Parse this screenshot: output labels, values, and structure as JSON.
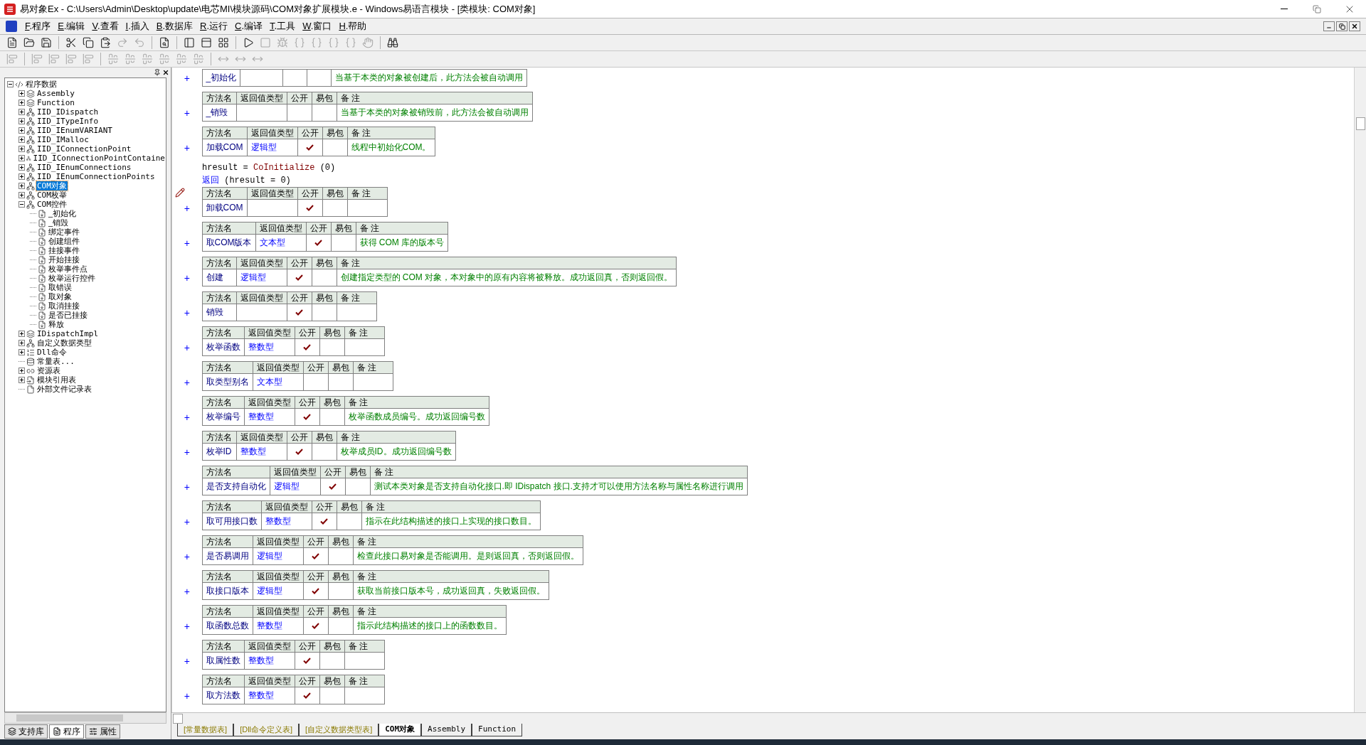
{
  "window": {
    "title": "易对象Ex - C:\\Users\\Admin\\Desktop\\update\\电芯MI\\模块源码\\COM对象扩展模块.e - Windows易语言模块 - [类模块: COM对象]"
  },
  "menu": [
    {
      "label": "F.程序"
    },
    {
      "label": "E.编辑"
    },
    {
      "label": "V.查看"
    },
    {
      "label": "I.插入"
    },
    {
      "label": "B.数据库"
    },
    {
      "label": "R.运行"
    },
    {
      "label": "C.编译"
    },
    {
      "label": "T.工具"
    },
    {
      "label": "W.窗口"
    },
    {
      "label": "H.帮助"
    }
  ],
  "toolbars": [
    [
      {
        "kind": "new",
        "disabled": false
      },
      {
        "kind": "open",
        "disabled": false
      },
      {
        "kind": "save",
        "disabled": false
      },
      {
        "kind": "sep"
      },
      {
        "kind": "cut",
        "disabled": false
      },
      {
        "kind": "copy",
        "disabled": false
      },
      {
        "kind": "paste",
        "disabled": false
      },
      {
        "kind": "redo",
        "disabled": true
      },
      {
        "kind": "undo",
        "disabled": true
      },
      {
        "kind": "sep"
      },
      {
        "kind": "find",
        "disabled": false
      },
      {
        "kind": "sep"
      },
      {
        "kind": "panel-left",
        "disabled": false
      },
      {
        "kind": "panel-top",
        "disabled": false
      },
      {
        "kind": "panel-grid",
        "disabled": false
      },
      {
        "kind": "sep"
      },
      {
        "kind": "run",
        "disabled": false
      },
      {
        "kind": "stop",
        "disabled": true
      },
      {
        "kind": "debug",
        "disabled": true
      },
      {
        "kind": "braces",
        "disabled": true
      },
      {
        "kind": "braces",
        "disabled": true
      },
      {
        "kind": "braces",
        "disabled": true
      },
      {
        "kind": "braces",
        "disabled": true
      },
      {
        "kind": "hand",
        "disabled": true
      },
      {
        "kind": "sep"
      },
      {
        "kind": "help",
        "disabled": false
      }
    ],
    [
      {
        "kind": "align",
        "disabled": true
      },
      {
        "kind": "sep"
      },
      {
        "kind": "align",
        "disabled": true
      },
      {
        "kind": "align",
        "disabled": true
      },
      {
        "kind": "align",
        "disabled": true
      },
      {
        "kind": "align",
        "disabled": true
      },
      {
        "kind": "sep"
      },
      {
        "kind": "center",
        "disabled": true
      },
      {
        "kind": "center",
        "disabled": true
      },
      {
        "kind": "center",
        "disabled": true
      },
      {
        "kind": "center",
        "disabled": true
      },
      {
        "kind": "center",
        "disabled": true
      },
      {
        "kind": "center",
        "disabled": true
      },
      {
        "kind": "sep"
      },
      {
        "kind": "size",
        "disabled": true
      },
      {
        "kind": "size",
        "disabled": true
      },
      {
        "kind": "size",
        "disabled": true
      }
    ]
  ],
  "tree": {
    "label": "程序数据",
    "kind": "root",
    "selected": false,
    "expanded": true,
    "children": [
      {
        "label": "Assembly",
        "kind": "library",
        "selected": false,
        "expanded": false
      },
      {
        "label": "Function",
        "kind": "library",
        "selected": false,
        "expanded": false
      },
      {
        "label": "IID_IDispatch",
        "kind": "class",
        "selected": false,
        "expanded": false
      },
      {
        "label": "IID_ITypeInfo",
        "kind": "class",
        "selected": false,
        "expanded": false
      },
      {
        "label": "IID_IEnumVARIANT",
        "kind": "class",
        "selected": false,
        "expanded": false
      },
      {
        "label": "IID_IMalloc",
        "kind": "class",
        "selected": false,
        "expanded": false
      },
      {
        "label": "IID_IConnectionPoint",
        "kind": "class",
        "selected": false,
        "expanded": false
      },
      {
        "label": "IID_IConnectionPointContaine",
        "kind": "class",
        "selected": false,
        "expanded": false
      },
      {
        "label": "IID_IEnumConnections",
        "kind": "class",
        "selected": false,
        "expanded": false
      },
      {
        "label": "IID_IEnumConnectionPoints",
        "kind": "class",
        "selected": false,
        "expanded": false
      },
      {
        "label": "COM对象",
        "kind": "class",
        "selected": true,
        "expanded": false
      },
      {
        "label": "COM枚举",
        "kind": "class",
        "selected": false,
        "expanded": false
      },
      {
        "label": "COM控件",
        "kind": "class",
        "selected": false,
        "expanded": true,
        "children": [
          {
            "label": "_初始化",
            "kind": "method",
            "selected": false
          },
          {
            "label": "_销毁",
            "kind": "method",
            "selected": false
          },
          {
            "label": "绑定事件",
            "kind": "method",
            "selected": false
          },
          {
            "label": "创建组件",
            "kind": "method",
            "selected": false
          },
          {
            "label": "挂接事件",
            "kind": "method",
            "selected": false
          },
          {
            "label": "开始挂接",
            "kind": "method",
            "selected": false
          },
          {
            "label": "枚举事件点",
            "kind": "method",
            "selected": false
          },
          {
            "label": "枚举运行控件",
            "kind": "method",
            "selected": false
          },
          {
            "label": "取错误",
            "kind": "method",
            "selected": false
          },
          {
            "label": "取对象",
            "kind": "method",
            "selected": false
          },
          {
            "label": "取消挂接",
            "kind": "method",
            "selected": false
          },
          {
            "label": "是否已挂接",
            "kind": "method",
            "selected": false
          },
          {
            "label": "释放",
            "kind": "method",
            "selected": false
          }
        ]
      },
      {
        "label": "IDispatchImpl",
        "kind": "library",
        "selected": false,
        "expanded": false
      },
      {
        "label": "自定义数据类型",
        "kind": "class",
        "selected": false,
        "expanded": false
      },
      {
        "label": "Dll命令",
        "kind": "dll",
        "selected": false,
        "expanded": false
      },
      {
        "label": "常量表...",
        "kind": "constants",
        "selected": false
      },
      {
        "label": "资源表",
        "kind": "resources",
        "selected": false,
        "expanded": false
      },
      {
        "label": "模块引用表",
        "kind": "modules",
        "selected": false,
        "expanded": false
      },
      {
        "label": "外部文件记录表",
        "kind": "files",
        "selected": false
      }
    ]
  },
  "sidebar_tabs": [
    {
      "label": "支持库",
      "kind": "library",
      "selected": false
    },
    {
      "label": "程序",
      "kind": "program",
      "selected": true
    },
    {
      "label": "属性",
      "kind": "props",
      "selected": false
    }
  ],
  "blocks": [
    {
      "kind": "method",
      "expander": "+",
      "header_shown": false,
      "marked": false,
      "name": "_初始化",
      "public": false,
      "easy_pkg": false,
      "note": "当基于本类的对象被创建后，此方法会被自动调用"
    },
    {
      "kind": "method",
      "expander": "+",
      "header_shown": true,
      "columns": [
        "方法名",
        "返回值类型",
        "公开",
        "易包",
        "备 注"
      ],
      "marked": false,
      "name": "_销毁",
      "public": false,
      "easy_pkg": false,
      "note": "当基于本类的对象被销毁前，此方法会被自动调用"
    },
    {
      "kind": "method",
      "expander": "+",
      "header_shown": true,
      "columns": [
        "方法名",
        "返回值类型",
        "公开",
        "易包",
        "备 注"
      ],
      "marked": false,
      "name": "加载COM",
      "return_type": "逻辑型",
      "public": true,
      "easy_pkg": false,
      "note": "线程中初始化COM。"
    },
    {
      "kind": "code",
      "segments": [
        {
          "kind": "plain",
          "text": "hresult = "
        },
        {
          "kind": "call",
          "text": "CoInitialize"
        },
        {
          "kind": "plain",
          "text": " (0)"
        }
      ]
    },
    {
      "kind": "code",
      "segments": [
        {
          "kind": "keyword",
          "text": "返回"
        },
        {
          "kind": "plain",
          "text": " (hresult = 0)"
        }
      ]
    },
    {
      "kind": "method",
      "expander": "+",
      "header_shown": true,
      "columns": [
        "方法名",
        "返回值类型",
        "公开",
        "易包",
        "备 注"
      ],
      "marked": true,
      "name": "卸载COM",
      "public": true,
      "easy_pkg": false
    },
    {
      "kind": "method",
      "expander": "+",
      "header_shown": true,
      "columns": [
        "方法名",
        "返回值类型",
        "公开",
        "易包",
        "备 注"
      ],
      "marked": false,
      "name": "取COM版本",
      "return_type": "文本型",
      "public": true,
      "easy_pkg": false,
      "note": "获得 COM 库的版本号"
    },
    {
      "kind": "method",
      "expander": "+",
      "header_shown": true,
      "columns": [
        "方法名",
        "返回值类型",
        "公开",
        "易包",
        "备 注"
      ],
      "marked": false,
      "name": "创建",
      "return_type": "逻辑型",
      "public": true,
      "easy_pkg": false,
      "note": "创建指定类型的 COM 对象，本对象中的原有内容将被释放。成功返回真，否则返回假。"
    },
    {
      "kind": "method",
      "expander": "+",
      "header_shown": true,
      "columns": [
        "方法名",
        "返回值类型",
        "公开",
        "易包",
        "备 注"
      ],
      "marked": false,
      "name": "销毁",
      "public": true,
      "easy_pkg": false
    },
    {
      "kind": "method",
      "expander": "+",
      "header_shown": true,
      "columns": [
        "方法名",
        "返回值类型",
        "公开",
        "易包",
        "备 注"
      ],
      "marked": false,
      "name": "枚举函数",
      "return_type": "整数型",
      "public": true,
      "easy_pkg": false
    },
    {
      "kind": "method",
      "expander": "+",
      "header_shown": true,
      "columns": [
        "方法名",
        "返回值类型",
        "公开",
        "易包",
        "备 注"
      ],
      "marked": false,
      "name": "取类型别名",
      "return_type": "文本型",
      "public": false,
      "easy_pkg": false
    },
    {
      "kind": "method",
      "expander": "+",
      "header_shown": true,
      "columns": [
        "方法名",
        "返回值类型",
        "公开",
        "易包",
        "备 注"
      ],
      "marked": false,
      "name": "枚举编号",
      "return_type": "整数型",
      "public": true,
      "easy_pkg": false,
      "note": "枚举函数成员编号。成功返回编号数"
    },
    {
      "kind": "method",
      "expander": "+",
      "header_shown": true,
      "columns": [
        "方法名",
        "返回值类型",
        "公开",
        "易包",
        "备 注"
      ],
      "marked": false,
      "name": "枚举ID",
      "return_type": "整数型",
      "public": true,
      "easy_pkg": false,
      "note": "枚举成员ID。成功返回编号数"
    },
    {
      "kind": "method",
      "expander": "+",
      "header_shown": true,
      "columns": [
        "方法名",
        "返回值类型",
        "公开",
        "易包",
        "备 注"
      ],
      "marked": false,
      "name": "是否支持自动化",
      "return_type": "逻辑型",
      "public": true,
      "easy_pkg": false,
      "note": "测试本类对象是否支持自动化接口.即 IDispatch 接口.支持才可以使用方法名称与属性名称进行调用"
    },
    {
      "kind": "method",
      "expander": "+",
      "header_shown": true,
      "columns": [
        "方法名",
        "返回值类型",
        "公开",
        "易包",
        "备 注"
      ],
      "marked": false,
      "name": "取可用接口数",
      "return_type": "整数型",
      "public": true,
      "easy_pkg": false,
      "note": "指示在此结构描述的接口上实现的接口数目。"
    },
    {
      "kind": "method",
      "expander": "+",
      "header_shown": true,
      "columns": [
        "方法名",
        "返回值类型",
        "公开",
        "易包",
        "备 注"
      ],
      "marked": false,
      "name": "是否易调用",
      "return_type": "逻辑型",
      "public": true,
      "easy_pkg": false,
      "note": "检查此接口易对象是否能调用。是则返回真，否则返回假。"
    },
    {
      "kind": "method",
      "expander": "+",
      "header_shown": true,
      "columns": [
        "方法名",
        "返回值类型",
        "公开",
        "易包",
        "备 注"
      ],
      "marked": false,
      "name": "取接口版本",
      "return_type": "逻辑型",
      "public": true,
      "easy_pkg": false,
      "note": "获取当前接口版本号，成功返回真，失败返回假。"
    },
    {
      "kind": "method",
      "expander": "+",
      "header_shown": true,
      "columns": [
        "方法名",
        "返回值类型",
        "公开",
        "易包",
        "备 注"
      ],
      "marked": false,
      "name": "取函数总数",
      "return_type": "整数型",
      "public": true,
      "easy_pkg": false,
      "note": "指示此结构描述的接口上的函数数目。"
    },
    {
      "kind": "method",
      "expander": "+",
      "header_shown": true,
      "columns": [
        "方法名",
        "返回值类型",
        "公开",
        "易包",
        "备 注"
      ],
      "marked": false,
      "name": "取属性数",
      "return_type": "整数型",
      "public": true,
      "easy_pkg": false
    },
    {
      "kind": "method",
      "expander": "+",
      "header_shown": true,
      "columns": [
        "方法名",
        "返回值类型",
        "公开",
        "易包",
        "备 注"
      ],
      "marked": false,
      "name": "取方法数",
      "return_type": "整数型",
      "public": true,
      "easy_pkg": false
    }
  ],
  "editor_tabs": [
    {
      "label": "[常量数据表]",
      "kind": "table",
      "selected": false
    },
    {
      "label": "[Dll命令定义表]",
      "kind": "table",
      "selected": false
    },
    {
      "label": "[自定义数据类型表]",
      "kind": "table",
      "selected": false
    },
    {
      "label": "COM对象",
      "kind": "class",
      "selected": true
    },
    {
      "label": "Assembly",
      "kind": "class",
      "selected": false
    },
    {
      "label": "Function",
      "kind": "class",
      "selected": false
    }
  ]
}
